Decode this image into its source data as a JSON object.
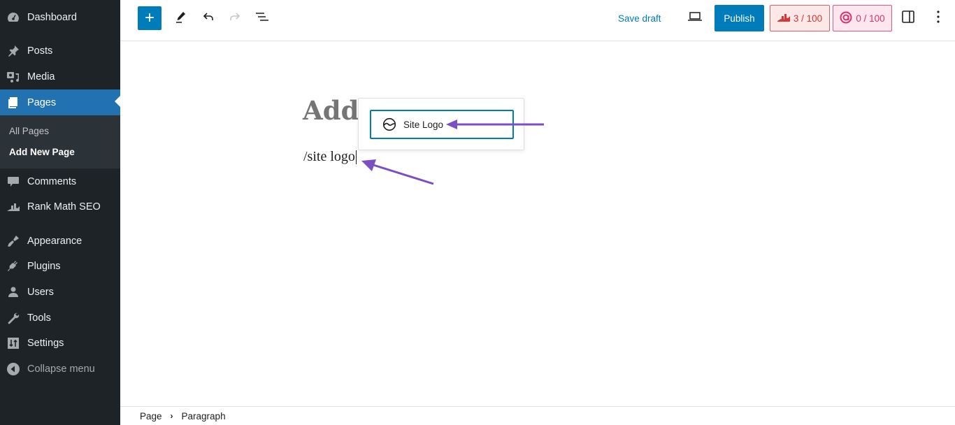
{
  "sidebar": {
    "items": [
      {
        "label": "Dashboard",
        "icon": "dashboard-icon"
      },
      {
        "label": "Posts",
        "icon": "pin-icon"
      },
      {
        "label": "Media",
        "icon": "media-icon"
      },
      {
        "label": "Pages",
        "icon": "pages-icon",
        "active": true
      },
      {
        "label": "Comments",
        "icon": "comment-icon"
      },
      {
        "label": "Rank Math SEO",
        "icon": "rank-math-icon"
      },
      {
        "label": "Appearance",
        "icon": "brush-icon"
      },
      {
        "label": "Plugins",
        "icon": "plug-icon"
      },
      {
        "label": "Users",
        "icon": "user-icon"
      },
      {
        "label": "Tools",
        "icon": "wrench-icon"
      },
      {
        "label": "Settings",
        "icon": "settings-icon"
      },
      {
        "label": "Collapse menu",
        "icon": "collapse-icon"
      }
    ],
    "submenu": [
      {
        "label": "All Pages"
      },
      {
        "label": "Add New Page",
        "current": true
      }
    ]
  },
  "toolbar": {
    "add_block": "+",
    "save_draft": "Save draft",
    "publish": "Publish",
    "seo_score": "3 / 100",
    "content_score": "0 / 100"
  },
  "editor": {
    "title_placeholder": "Add",
    "paragraph_text": "/site logo",
    "inserter_suggestion": "Site Logo"
  },
  "colors": {
    "accent": "#007cba",
    "sidebar_bg": "#1d2327",
    "active_menu": "#2271b1",
    "annotation_arrow": "#7b4fc4"
  },
  "breadcrumb": {
    "items": [
      "Page",
      "Paragraph"
    ],
    "separator": "›"
  }
}
